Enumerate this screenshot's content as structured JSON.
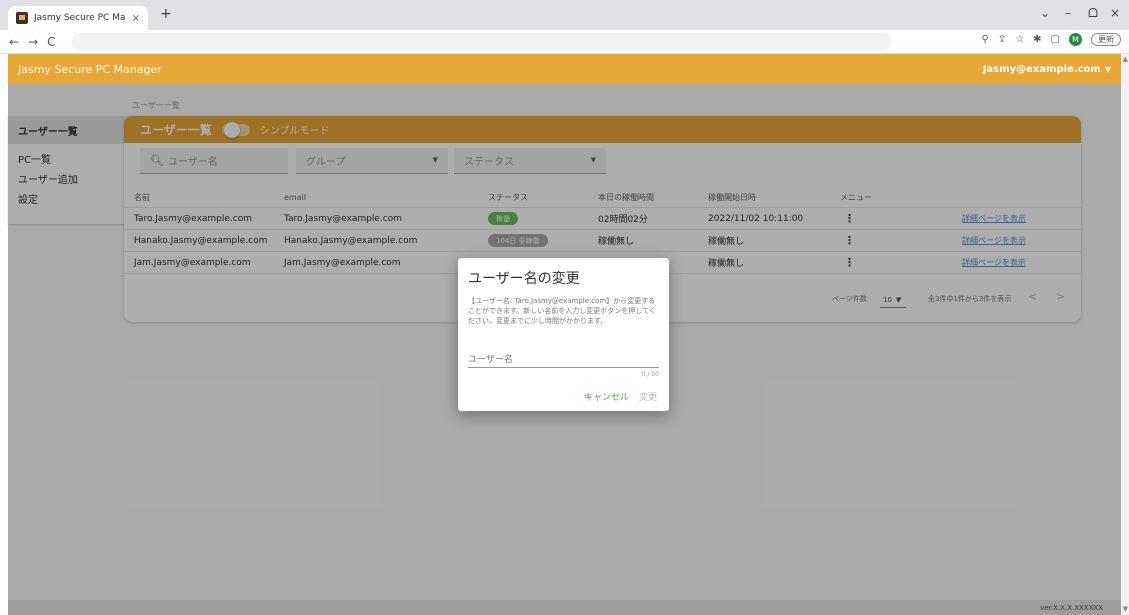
{
  "browser": {
    "tab_title": "Jasmy Secure PC Manager",
    "tab_close": "×",
    "new_tab": "+",
    "minimize": "–",
    "restore": "ᗝ",
    "close": "×",
    "dropdown": "⌄",
    "back": "←",
    "forward": "→",
    "reload": "C",
    "update_label": "更新"
  },
  "header": {
    "app_title": "Jasmy Secure PC Manager",
    "user": "Jasmy@example.com"
  },
  "sidebar": {
    "items": [
      {
        "label": "ユーザー一覧"
      },
      {
        "label": "PC一覧"
      },
      {
        "label": "ユーザー追加"
      },
      {
        "label": "設定"
      }
    ]
  },
  "breadcrumb": "ユーザー一覧",
  "card": {
    "title": "ユーザー一覧",
    "toggle_label": "シンプルモード",
    "filters": {
      "search_placeholder": "ユーザー名",
      "group_placeholder": "グループ",
      "status_placeholder": "ステータス"
    },
    "columns": [
      "名前",
      "email",
      "ステータス",
      "本日の稼働時間",
      "稼働開始日時",
      "メニュー"
    ],
    "rows": [
      {
        "name": "Taro.Jasmy@example.com",
        "email": "Taro.Jasmy@example.com",
        "status": "稼働",
        "status_color": "#6bbf59",
        "work_time": "02時間02分",
        "start": "2022/11/02 10:11:00",
        "menu": "⋮",
        "link": "詳細ページを表示"
      },
      {
        "name": "Hanako.Jasmy@example.com",
        "email": "Hanako.Jasmy@example.com",
        "status": "104日 非稼働",
        "status_color": "#a8a8a8",
        "work_time": "稼働無し",
        "start": "稼働無し",
        "menu": "⋮",
        "link": "詳細ページを表示"
      },
      {
        "name": "Jam.Jasmy@example.com",
        "email": "Jam.Jasmy@example.com",
        "status": "",
        "status_color": "",
        "work_time": "稼働無し",
        "start": "稼働無し",
        "menu": "⋮",
        "link": "詳細ページを表示"
      }
    ],
    "pagination": {
      "per_page_label": "ページ件数",
      "per_page": "10",
      "summary": "全3件中1件から3件を表示",
      "prev": "<",
      "next": ">"
    }
  },
  "dialog": {
    "title": "ユーザー名の変更",
    "message": "【ユーザー名: Taro.Jasmy@example.com】から変更することができます。新しい名前を入力し変更ボタンを押してください。変更までに少し時間がかかります。",
    "input_label": "ユーザー名",
    "counter": "0 / 50",
    "cancel": "キャンセル",
    "confirm": "変更"
  },
  "footer": {
    "version": "ver.X.X.X.XXXXXX"
  },
  "colors": {
    "brand": "#e8a838",
    "status_active": "#6bbf59",
    "status_inactive": "#a8a8a8",
    "link": "#5b8fd4",
    "cancel": "#5aa84c"
  }
}
